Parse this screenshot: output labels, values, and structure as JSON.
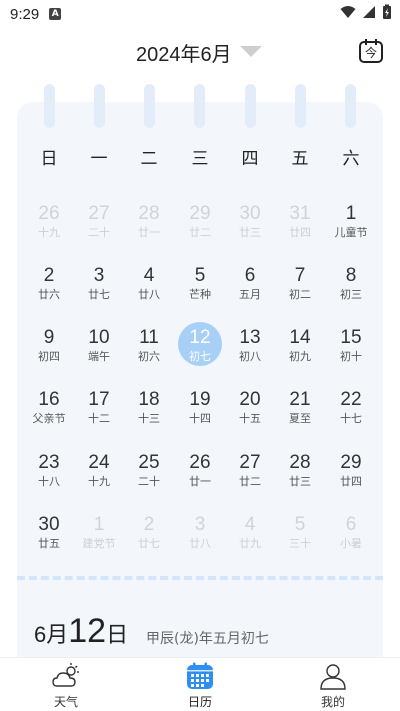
{
  "status": {
    "time": "9:29",
    "notification": "A"
  },
  "header": {
    "title": "2024年6月",
    "today_label": "今"
  },
  "weekdays": [
    "日",
    "一",
    "二",
    "三",
    "四",
    "五",
    "六"
  ],
  "weeks": [
    [
      {
        "d": "26",
        "l": "十九",
        "cur": false
      },
      {
        "d": "27",
        "l": "二十",
        "cur": false
      },
      {
        "d": "28",
        "l": "廿一",
        "cur": false
      },
      {
        "d": "29",
        "l": "廿二",
        "cur": false
      },
      {
        "d": "30",
        "l": "廿三",
        "cur": false
      },
      {
        "d": "31",
        "l": "廿四",
        "cur": false
      },
      {
        "d": "1",
        "l": "儿童节",
        "cur": true
      }
    ],
    [
      {
        "d": "2",
        "l": "廿六",
        "cur": true
      },
      {
        "d": "3",
        "l": "廿七",
        "cur": true
      },
      {
        "d": "4",
        "l": "廿八",
        "cur": true
      },
      {
        "d": "5",
        "l": "芒种",
        "cur": true
      },
      {
        "d": "6",
        "l": "五月",
        "cur": true
      },
      {
        "d": "7",
        "l": "初二",
        "cur": true
      },
      {
        "d": "8",
        "l": "初三",
        "cur": true
      }
    ],
    [
      {
        "d": "9",
        "l": "初四",
        "cur": true
      },
      {
        "d": "10",
        "l": "端午",
        "cur": true
      },
      {
        "d": "11",
        "l": "初六",
        "cur": true
      },
      {
        "d": "12",
        "l": "初七",
        "cur": true,
        "selected": true
      },
      {
        "d": "13",
        "l": "初八",
        "cur": true
      },
      {
        "d": "14",
        "l": "初九",
        "cur": true
      },
      {
        "d": "15",
        "l": "初十",
        "cur": true
      }
    ],
    [
      {
        "d": "16",
        "l": "父亲节",
        "cur": true
      },
      {
        "d": "17",
        "l": "十二",
        "cur": true
      },
      {
        "d": "18",
        "l": "十三",
        "cur": true
      },
      {
        "d": "19",
        "l": "十四",
        "cur": true
      },
      {
        "d": "20",
        "l": "十五",
        "cur": true
      },
      {
        "d": "21",
        "l": "夏至",
        "cur": true
      },
      {
        "d": "22",
        "l": "十七",
        "cur": true
      }
    ],
    [
      {
        "d": "23",
        "l": "十八",
        "cur": true
      },
      {
        "d": "24",
        "l": "十九",
        "cur": true
      },
      {
        "d": "25",
        "l": "二十",
        "cur": true
      },
      {
        "d": "26",
        "l": "廿一",
        "cur": true
      },
      {
        "d": "27",
        "l": "廿二",
        "cur": true
      },
      {
        "d": "28",
        "l": "廿三",
        "cur": true
      },
      {
        "d": "29",
        "l": "廿四",
        "cur": true
      }
    ],
    [
      {
        "d": "30",
        "l": "廿五",
        "cur": true
      },
      {
        "d": "1",
        "l": "建党节",
        "cur": false
      },
      {
        "d": "2",
        "l": "廿七",
        "cur": false
      },
      {
        "d": "3",
        "l": "廿八",
        "cur": false
      },
      {
        "d": "4",
        "l": "廿九",
        "cur": false
      },
      {
        "d": "5",
        "l": "三十",
        "cur": false
      },
      {
        "d": "6",
        "l": "小暑",
        "cur": false
      }
    ]
  ],
  "detail": {
    "month": "6月",
    "day": "12",
    "day_suffix": "日",
    "lunar": "甲辰(龙)年五月初七"
  },
  "tabs": [
    {
      "label": "天气",
      "icon": "weather-cloud-sun-icon",
      "active": false
    },
    {
      "label": "日历",
      "icon": "calendar-icon",
      "active": true
    },
    {
      "label": "我的",
      "icon": "user-profile-icon",
      "active": false
    }
  ],
  "colors": {
    "accent": "#2e8ff0",
    "selected": "#a8d0f6",
    "card_bg": "#f3f7fc"
  }
}
